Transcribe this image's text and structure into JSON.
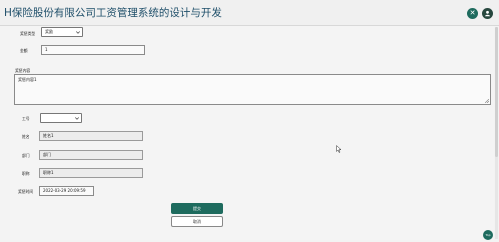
{
  "header": {
    "title": "H保险股份有限公司工资管理系统的设计与开发",
    "close_icon": "close-icon",
    "user_icon": "user-icon"
  },
  "form": {
    "type_label": "奖惩类型",
    "type_value": "奖励",
    "amount_label": "金额",
    "amount_value": "1",
    "content_label": "奖惩内容",
    "content_value": "奖惩内容1",
    "emp_no_label": "工号",
    "emp_no_value": "",
    "name_label": "姓名",
    "name_value": "姓名1",
    "dept_label": "部门",
    "dept_value": "部门",
    "position_label": "职称",
    "position_value": "职称1",
    "time_label": "奖惩时间",
    "time_value": "2022-03-29 20:09:59"
  },
  "actions": {
    "submit_label": "提交",
    "cancel_label": "取消"
  },
  "fab": {
    "label": "Top"
  },
  "colors": {
    "primary": "#1e6b5e",
    "title": "#1f4f6a"
  }
}
